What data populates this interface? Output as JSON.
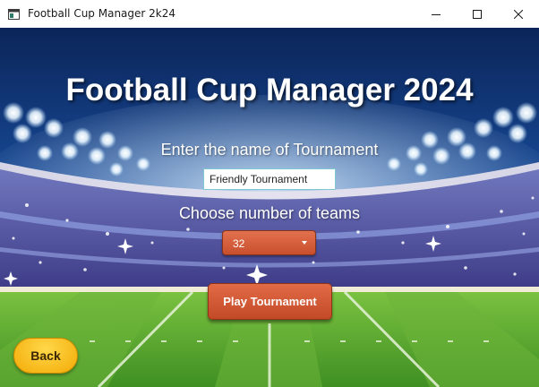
{
  "window": {
    "title": "Football Cup Manager 2k24",
    "icons": {
      "app": "app-window-icon",
      "minimize": "minimize-icon",
      "maximize": "maximize-icon",
      "close": "close-icon"
    }
  },
  "main": {
    "heading": "Football Cup Manager 2024",
    "tournament_label": "Enter the name of Tournament",
    "tournament_name": "Friendly Tournament",
    "teams_label": "Choose number of teams",
    "teams_selected": "32",
    "play_label": "Play Tournament",
    "back_label": "Back"
  },
  "colors": {
    "accent_button": "#d55a35",
    "back_button": "#f6b40e",
    "input_border": "#7ec8d6",
    "sky": "#0f2f6b",
    "pitch": "#5aa82e"
  }
}
